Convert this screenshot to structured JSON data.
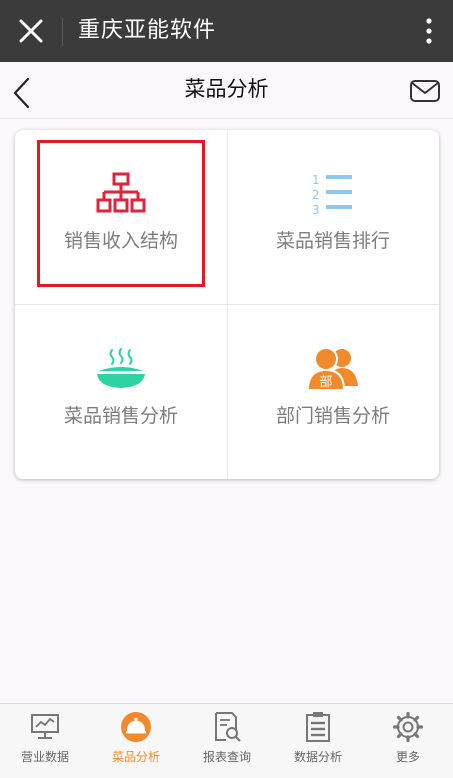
{
  "app_bar": {
    "title": "重庆亚能软件",
    "close_icon": "close-icon",
    "more_icon": "more-vertical-icon"
  },
  "header": {
    "title": "菜品分析",
    "back_icon": "chevron-left-icon",
    "mail_icon": "mail-icon"
  },
  "grid": {
    "items": [
      {
        "label": "销售收入结构",
        "icon": "org-chart-icon",
        "color": "#e0223a",
        "highlighted": true
      },
      {
        "label": "菜品销售排行",
        "icon": "ranked-list-icon",
        "color": "#8cc8ef"
      },
      {
        "label": "菜品销售分析",
        "icon": "steaming-bowl-icon",
        "color": "#2fd3a3"
      },
      {
        "label": "部门销售分析",
        "icon": "department-people-icon",
        "color": "#f08a2c",
        "badge": "部"
      }
    ]
  },
  "bottom_nav": {
    "items": [
      {
        "label": "营业数据",
        "icon": "monitor-chart-icon"
      },
      {
        "label": "菜品分析",
        "icon": "dish-cover-icon",
        "active": true
      },
      {
        "label": "报表查询",
        "icon": "report-search-icon"
      },
      {
        "label": "数据分析",
        "icon": "clipboard-icon"
      },
      {
        "label": "更多",
        "icon": "gear-icon"
      }
    ]
  },
  "colors": {
    "app_bar_bg": "#3b3b3b",
    "active_nav": "#f08a2c",
    "highlight_border": "#e21b22"
  }
}
